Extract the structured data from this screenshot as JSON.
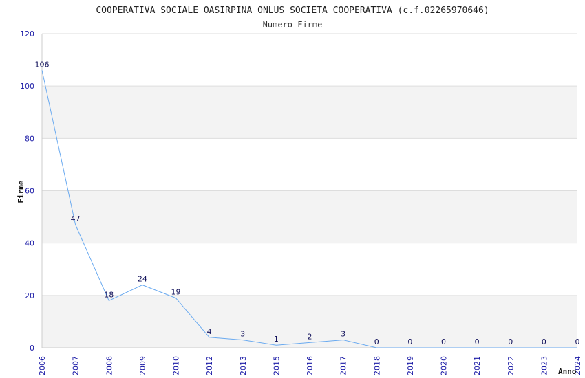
{
  "chart_data": {
    "type": "line",
    "title": "COOPERATIVA SOCIALE OASIRPINA ONLUS SOCIETA COOPERATIVA (c.f.02265970646)",
    "subtitle": "Numero Firme",
    "xlabel": "Anno",
    "ylabel": "Firme",
    "categories": [
      "2006",
      "2007",
      "2008",
      "2009",
      "2010",
      "2012",
      "2013",
      "2015",
      "2016",
      "2017",
      "2018",
      "2019",
      "2020",
      "2021",
      "2022",
      "2023",
      "2024"
    ],
    "series": [
      {
        "values": [
          106,
          47,
          18,
          24,
          19,
          4,
          3,
          1,
          2,
          3,
          0,
          0,
          0,
          0,
          0,
          0,
          0
        ]
      }
    ],
    "ylim": [
      0,
      120
    ],
    "yticks": [
      0,
      20,
      40,
      60,
      80,
      100,
      120
    ],
    "grid": true,
    "band_color": "#f3f3f3",
    "line_color": "#6aaaf0",
    "tick_color": "#1a1aa6"
  }
}
